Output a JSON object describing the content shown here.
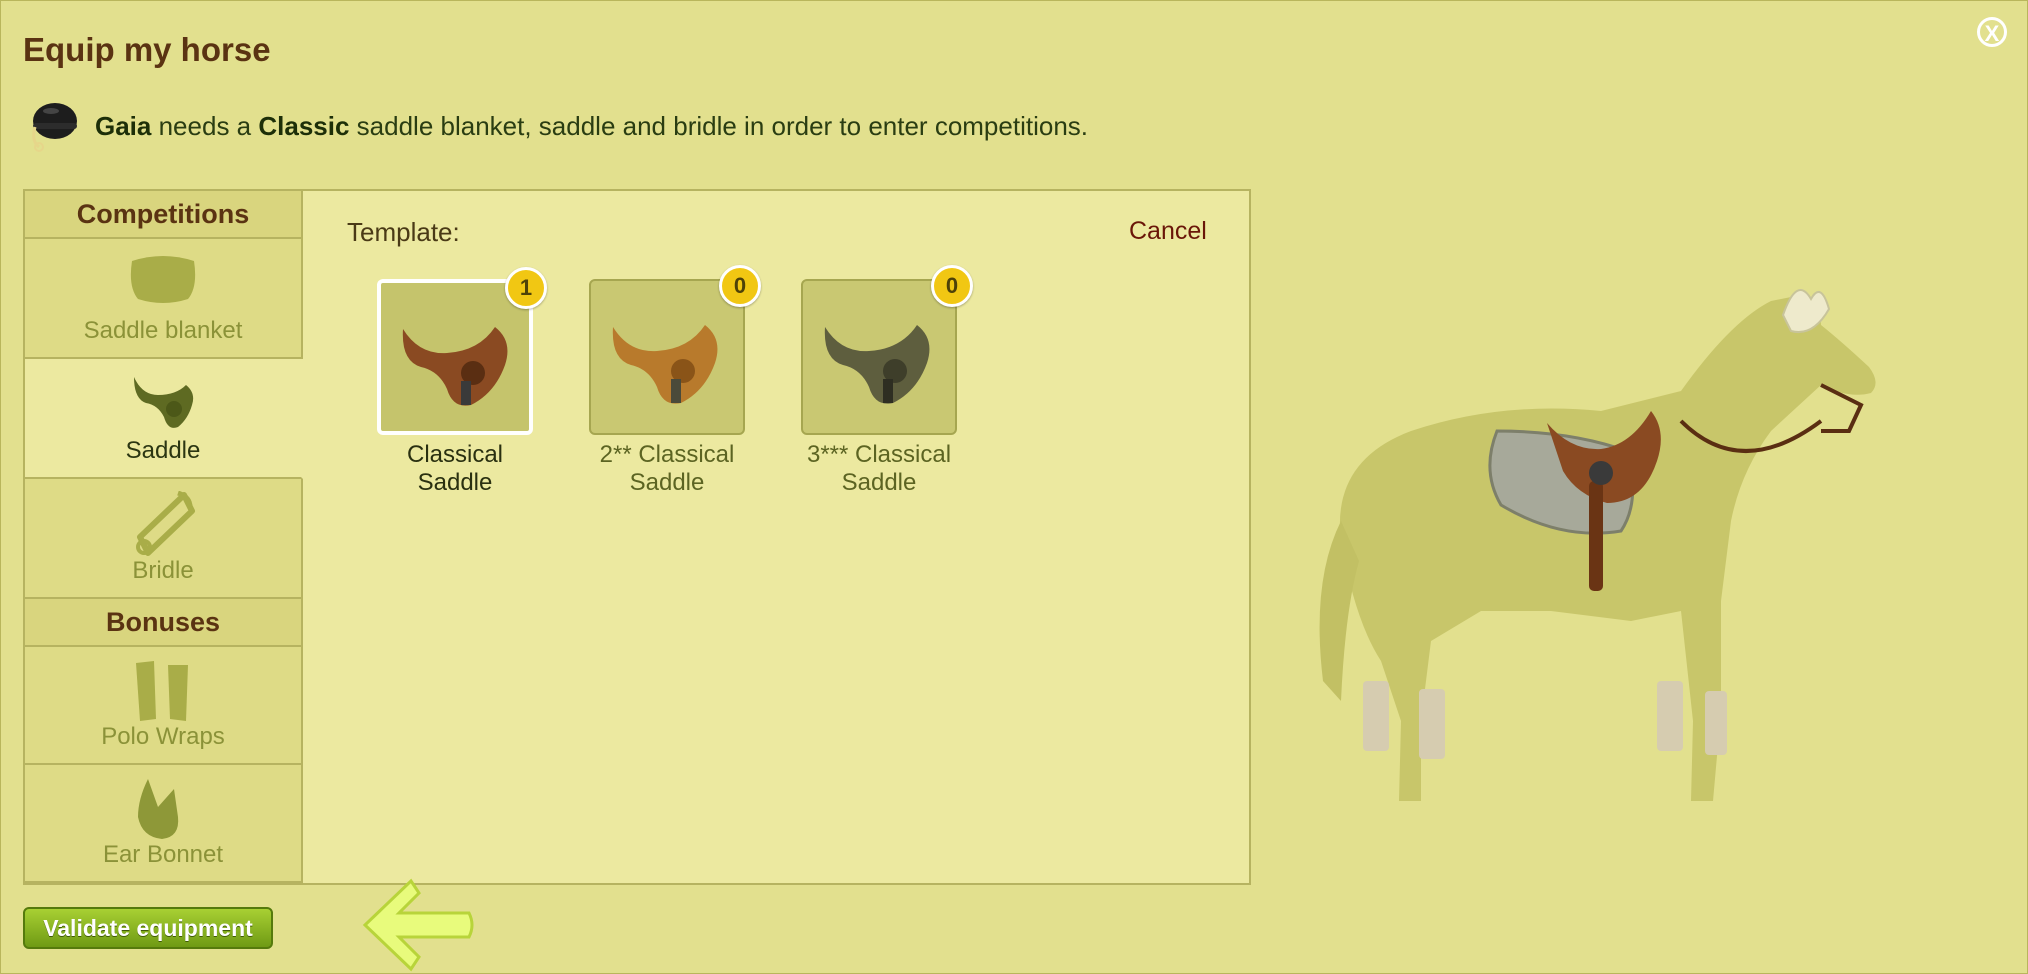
{
  "dialog": {
    "title": "Equip my horse",
    "close_label": "X"
  },
  "notice": {
    "horse_name": "Gaia",
    "text_1": " needs a ",
    "level": "Classic",
    "text_2": " saddle blanket, saddle and bridle in order to enter competitions."
  },
  "sidebar": {
    "competitions_header": "Competitions",
    "bonuses_header": "Bonuses",
    "items": [
      {
        "label": "Saddle blanket",
        "icon": "saddle-blanket-icon"
      },
      {
        "label": "Saddle",
        "icon": "saddle-icon"
      },
      {
        "label": "Bridle",
        "icon": "bridle-icon"
      },
      {
        "label": "Polo Wraps",
        "icon": "polo-wraps-icon"
      },
      {
        "label": "Ear Bonnet",
        "icon": "ear-bonnet-icon"
      }
    ],
    "selected": "Saddle"
  },
  "main": {
    "template_label": "Template:",
    "cancel_label": "Cancel",
    "items": [
      {
        "line1": "Classical",
        "line2": "Saddle",
        "count": "1",
        "color": "#8a4a22"
      },
      {
        "line1": "2** Classical",
        "line2": "Saddle",
        "count": "0",
        "color": "#b87a2c"
      },
      {
        "line1": "3*** Classical",
        "line2": "Saddle",
        "count": "0",
        "color": "#5e5e3e"
      }
    ]
  },
  "footer": {
    "validate_label": "Validate equipment"
  },
  "colors": {
    "background": "#e2e08e",
    "title": "#5a3312",
    "badge": "#f1c713",
    "button": "#7fa61c"
  }
}
